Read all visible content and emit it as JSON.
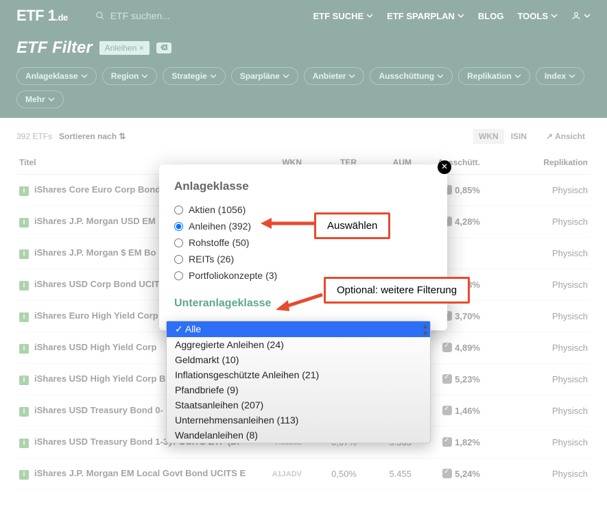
{
  "header": {
    "logo_main": "ETF 1",
    "logo_suffix": ".de",
    "search_placeholder": "ETF suchen...",
    "nav": [
      "ETF SUCHE",
      "ETF SPARPLAN",
      "BLOG",
      "TOOLS"
    ]
  },
  "subheader": {
    "title": "ETF Filter",
    "chip": "Anleihen ×",
    "clear_icon": "×"
  },
  "filters": [
    "Anlageklasse",
    "Region",
    "Strategie",
    "Sparpläne",
    "Anbieter",
    "Ausschüttung",
    "Replikation",
    "Index",
    "Mehr"
  ],
  "toolbar": {
    "count": "392 ETFs",
    "sort": "Sortieren nach",
    "seg_wkn": "WKN",
    "seg_isin": "ISIN",
    "view": "Ansicht"
  },
  "columns": {
    "title": "Titel",
    "wkn": "WKN",
    "ter": "TER",
    "aum": "AUM",
    "dist": "Ausschütt.",
    "repl": "Replikation"
  },
  "rows": [
    {
      "name": "iShares Core Euro Corp Bond",
      "wkn": "",
      "ter": "",
      "aum": "",
      "dist": "0,85%",
      "repl": "Physisch"
    },
    {
      "name": "iShares J.P. Morgan USD EM",
      "wkn": "",
      "ter": "",
      "aum": "",
      "dist": "4,28%",
      "repl": "Physisch"
    },
    {
      "name": "iShares J.P. Morgan $ EM Bo",
      "wkn": "",
      "ter": "",
      "aum": "",
      "dist": "",
      "repl": "Physisch"
    },
    {
      "name": "iShares USD Corp Bond UCIT",
      "wkn": "",
      "ter": "",
      "aum": "",
      "dist": "3,13%",
      "repl": "Physisch"
    },
    {
      "name": "iShares Euro High Yield Corp",
      "wkn": "",
      "ter": "",
      "aum": "",
      "dist": "3,70%",
      "repl": "Physisch"
    },
    {
      "name": "iShares USD High Yield Corp",
      "wkn": "",
      "ter": "",
      "aum": "",
      "dist": "4,89%",
      "repl": "Physisch"
    },
    {
      "name": "iShares USD High Yield Corp B",
      "wkn": "",
      "ter": "",
      "aum": "",
      "dist": "5,23%",
      "repl": "Physisch"
    },
    {
      "name": "iShares USD Treasury Bond 0-",
      "wkn": "",
      "ter": "",
      "aum": "",
      "dist": "1,46%",
      "repl": "Physisch"
    },
    {
      "name": "iShares USD Treasury Bond 1-3yr UCITS ETF (Di",
      "wkn": "A0J202",
      "ter": "0,07%",
      "aum": "5.565",
      "dist": "1,82%",
      "repl": "Physisch"
    },
    {
      "name": "iShares J.P. Morgan EM Local Govt Bond UCITS E",
      "wkn": "A1JADV",
      "ter": "0,50%",
      "aum": "5.455",
      "dist": "5,24%",
      "repl": "Physisch"
    }
  ],
  "modal": {
    "title": "Anlageklasse",
    "options": [
      "Aktien (1056)",
      "Anleihen (392)",
      "Rohstoffe (50)",
      "REITs (26)",
      "Portfoliokonzepte (3)"
    ],
    "selected_index": 1,
    "subtitle": "Unteranlageklasse"
  },
  "dropdown": {
    "options": [
      "Alle",
      "Aggregierte Anleihen (24)",
      "Geldmarkt (10)",
      "Inflationsgeschützte Anleihen (21)",
      "Pfandbriefe (9)",
      "Staatsanleihen (207)",
      "Unternehmensanleihen (113)",
      "Wandelanleihen (8)"
    ]
  },
  "callouts": {
    "select": "Auswählen",
    "optional": "Optional: weitere Filterung"
  }
}
